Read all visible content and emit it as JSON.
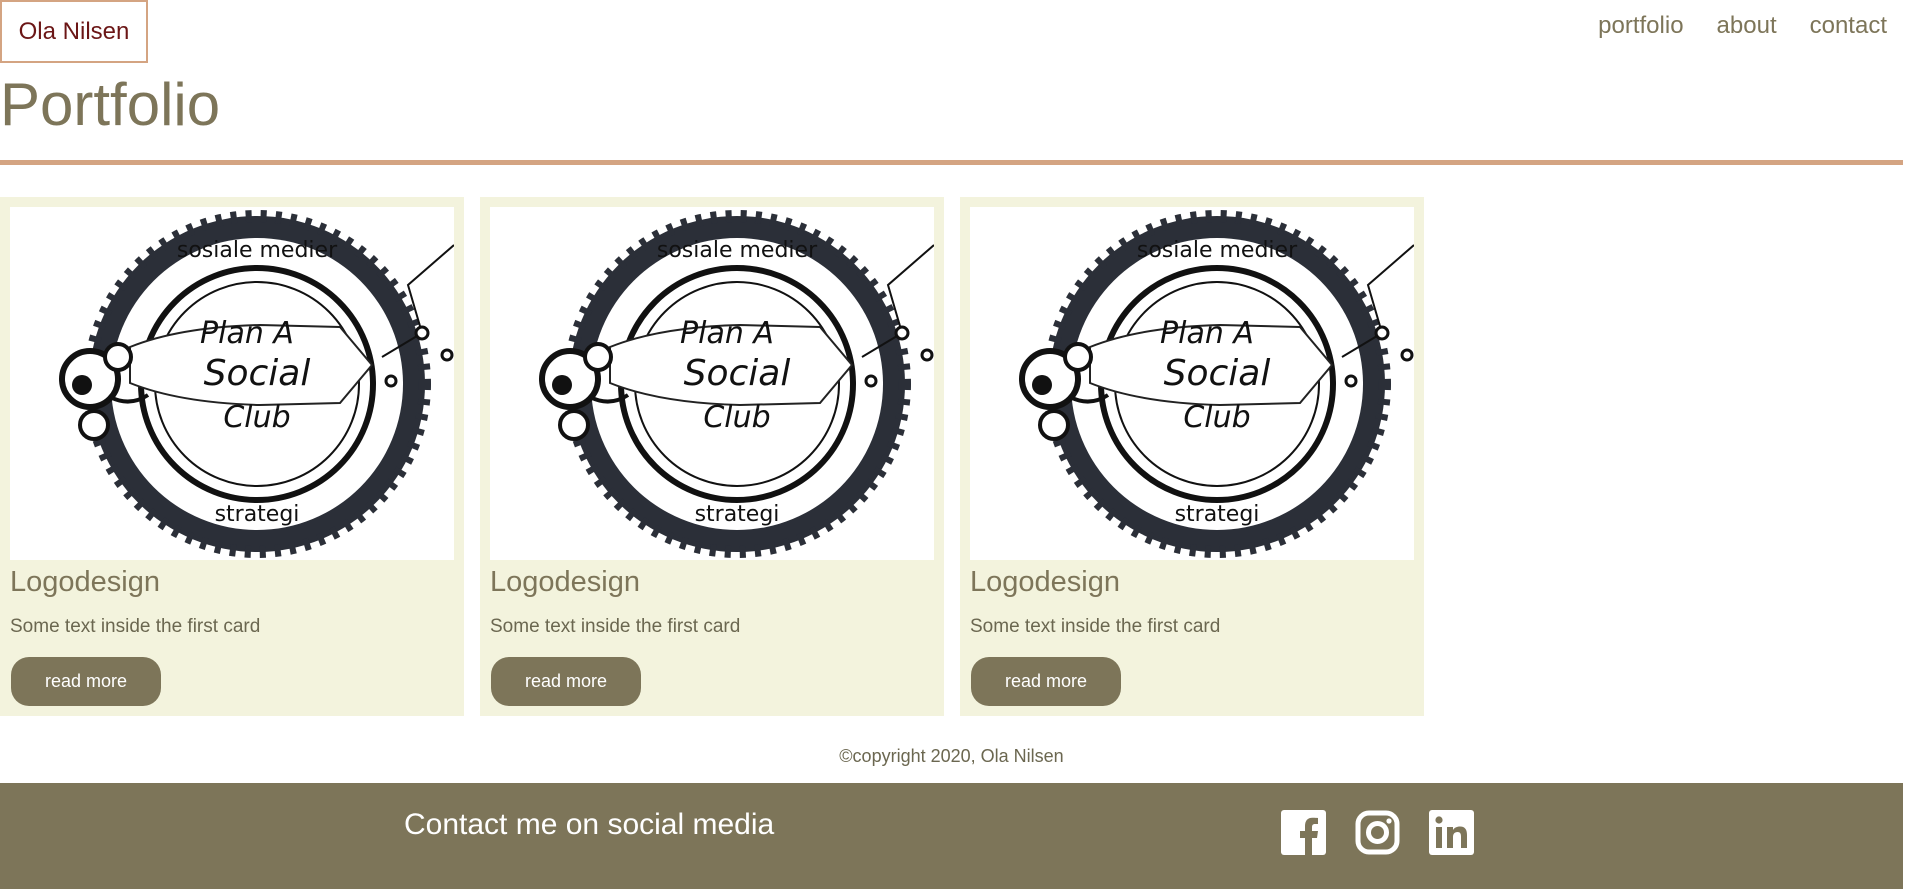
{
  "header": {
    "brand": "Ola Nilsen",
    "nav": [
      "portfolio",
      "about",
      "contact"
    ]
  },
  "page": {
    "title": "Portfolio"
  },
  "cards": [
    {
      "image_text": {
        "top": "sosiale medier",
        "line1": "Plan A",
        "line2": "Social",
        "line3": "Club",
        "bottom": "strategi"
      },
      "title": "Logodesign",
      "text": "Some text inside the first card",
      "button": "read more"
    },
    {
      "image_text": {
        "top": "sosiale medier",
        "line1": "Plan A",
        "line2": "Social",
        "line3": "Club",
        "bottom": "strategi"
      },
      "title": "Logodesign",
      "text": "Some text inside the first card",
      "button": "read more"
    },
    {
      "image_text": {
        "top": "sosiale medier",
        "line1": "Plan A",
        "line2": "Social",
        "line3": "Club",
        "bottom": "strategi"
      },
      "title": "Logodesign",
      "text": "Some text inside the first card",
      "button": "read more"
    }
  ],
  "copyright": "©copyright 2020, Ola Nilsen",
  "footer": {
    "title": "Contact me on social media",
    "icons": [
      "facebook-icon",
      "instagram-icon",
      "linkedin-icon"
    ]
  },
  "colors": {
    "olive": "#7d7559",
    "accent": "#d4a482",
    "card_bg": "#f3f3dd",
    "brand_text": "#6b1616"
  }
}
